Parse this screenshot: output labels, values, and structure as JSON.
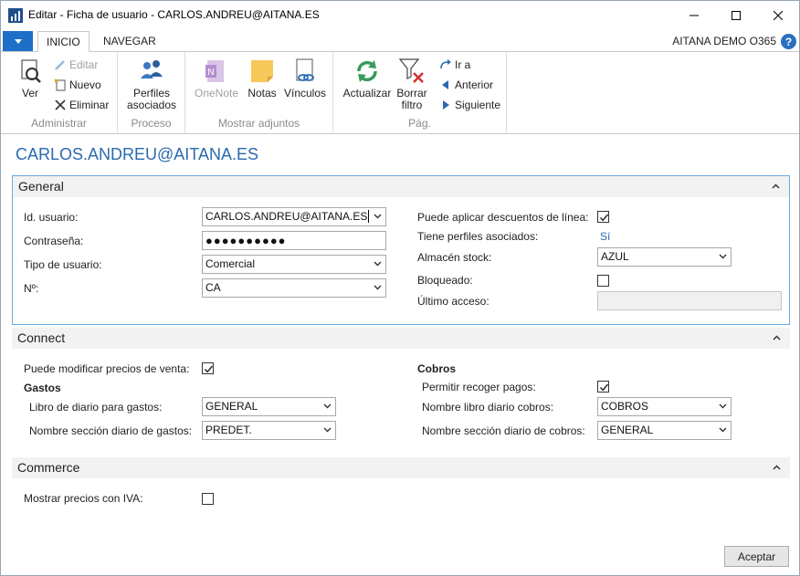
{
  "window": {
    "title": "Editar - Ficha de usuario - CARLOS.ANDREU@AITANA.ES"
  },
  "ribbon": {
    "tabs": [
      {
        "label": "INICIO",
        "active": true
      },
      {
        "label": "NAVEGAR",
        "active": false
      }
    ],
    "company": "AITANA DEMO O365",
    "help_glyph": "?",
    "groups": {
      "administrar": {
        "label": "Administrar",
        "ver": "Ver",
        "editar": "Editar",
        "nuevo": "Nuevo",
        "eliminar": "Eliminar"
      },
      "proceso": {
        "label": "Proceso",
        "perfiles_line1": "Perfiles",
        "perfiles_line2": "asociados"
      },
      "adjuntos": {
        "label": "Mostrar adjuntos",
        "onenote": "OneNote",
        "notas": "Notas",
        "vinculos": "Vínculos"
      },
      "pag": {
        "label": "Pág.",
        "actualizar": "Actualizar",
        "borrar_line1": "Borrar",
        "borrar_line2": "filtro",
        "ir_a": "Ir a",
        "anterior": "Anterior",
        "siguiente": "Siguiente"
      }
    }
  },
  "page_title": "CARLOS.ANDREU@AITANA.ES",
  "general": {
    "header": "General",
    "id_usuario": {
      "label": "Id. usuario:",
      "value": "CARLOS.ANDREU@AITANA.ES"
    },
    "contrasena": {
      "label": "Contraseña:",
      "value": "●●●●●●●●●●"
    },
    "tipo_usuario": {
      "label": "Tipo de usuario:",
      "value": "Comercial"
    },
    "numero": {
      "label": "Nº:",
      "value": "CA"
    },
    "descuentos": {
      "label": "Puede aplicar descuentos de línea:",
      "checked": true
    },
    "perfiles": {
      "label": "Tiene perfiles asociados:",
      "value": "Sí"
    },
    "almacen": {
      "label": "Almacén stock:",
      "value": "AZUL"
    },
    "bloqueado": {
      "label": "Bloqueado:",
      "checked": false
    },
    "ultimo_acceso": {
      "label": "Último acceso:",
      "value": ""
    }
  },
  "connect": {
    "header": "Connect",
    "modificar_precios": {
      "label": "Puede modificar precios de venta:",
      "checked": true
    },
    "gastos": {
      "title": "Gastos",
      "libro": {
        "label": "Libro de diario para gastos:",
        "value": "GENERAL"
      },
      "seccion": {
        "label": "Nombre sección diario de gastos:",
        "value": "PREDET."
      }
    },
    "cobros": {
      "title": "Cobros",
      "permitir": {
        "label": "Permitir recoger pagos:",
        "checked": true
      },
      "libro": {
        "label": "Nombre libro diario cobros:",
        "value": "COBROS"
      },
      "seccion": {
        "label": "Nombre sección diario de cobros:",
        "value": "GENERAL"
      }
    }
  },
  "commerce": {
    "header": "Commerce",
    "precios_iva": {
      "label": "Mostrar precios con IVA:",
      "checked": false
    }
  },
  "footer": {
    "accept": "Aceptar"
  },
  "colors": {
    "accent": "#1e6fc7",
    "title_blue": "#2a6ab0",
    "focus_border": "#6aa8e0"
  }
}
